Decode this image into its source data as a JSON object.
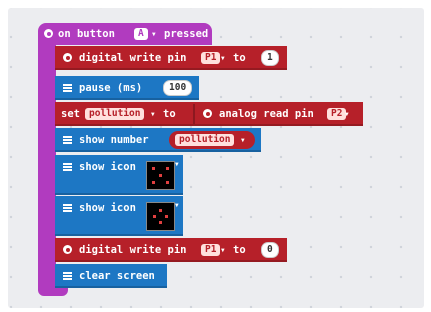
{
  "event": {
    "prefix": "on button",
    "button": "A",
    "suffix": "pressed"
  },
  "blocks": [
    {
      "type": "digital-write",
      "label": "digital write pin",
      "pin": "P1",
      "to": "to",
      "value": "1"
    },
    {
      "type": "pause",
      "label": "pause (ms)",
      "value": "100"
    },
    {
      "type": "set",
      "label": "set",
      "variable": "pollution",
      "to": "to",
      "read_label": "analog read pin",
      "pin": "P2"
    },
    {
      "type": "show-number",
      "label": "show number",
      "variable": "pollution"
    },
    {
      "type": "show-icon",
      "label": "show icon"
    },
    {
      "type": "show-icon",
      "label": "show icon"
    },
    {
      "type": "digital-write",
      "label": "digital write pin",
      "pin": "P1",
      "to": "to",
      "value": "0"
    },
    {
      "type": "clear-screen",
      "label": "clear screen"
    }
  ],
  "colors": {
    "event": "#b13bbf",
    "pins": "#b62029",
    "basic": "#1d77c4",
    "workspace": "#ecedf0"
  }
}
